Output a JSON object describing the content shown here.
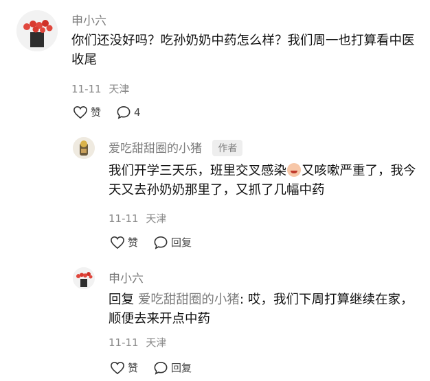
{
  "comments": [
    {
      "user": "申小六",
      "text": "你们还没好吗？吃孙奶奶中药怎么样？我们周一也打算看中医收尾",
      "date": "11-11",
      "location": "天津",
      "like_label": "赞",
      "reply_count": "4"
    },
    {
      "user": "爱吃甜甜圈的小猪",
      "author_tag": "作者",
      "text_part1": "我们开学三天乐，班里交叉感染",
      "text_part2": "又咳嗽严重了，我今天又去孙奶奶那里了，又抓了几幅中药",
      "date": "11-11",
      "location": "天津",
      "like_label": "赞",
      "reply_label": "回复"
    },
    {
      "user": "申小六",
      "reply_prefix": "回复",
      "mention": "爱吃甜甜圈的小猪",
      "text": ": 哎，我们下周打算继续在家，顺便去来开点中药",
      "date": "11-11",
      "location": "天津",
      "like_label": "赞",
      "reply_label": "回复"
    }
  ],
  "icons": [
    "heart-outline-icon",
    "chat-bubble-icon",
    "crying-face-emoji"
  ]
}
